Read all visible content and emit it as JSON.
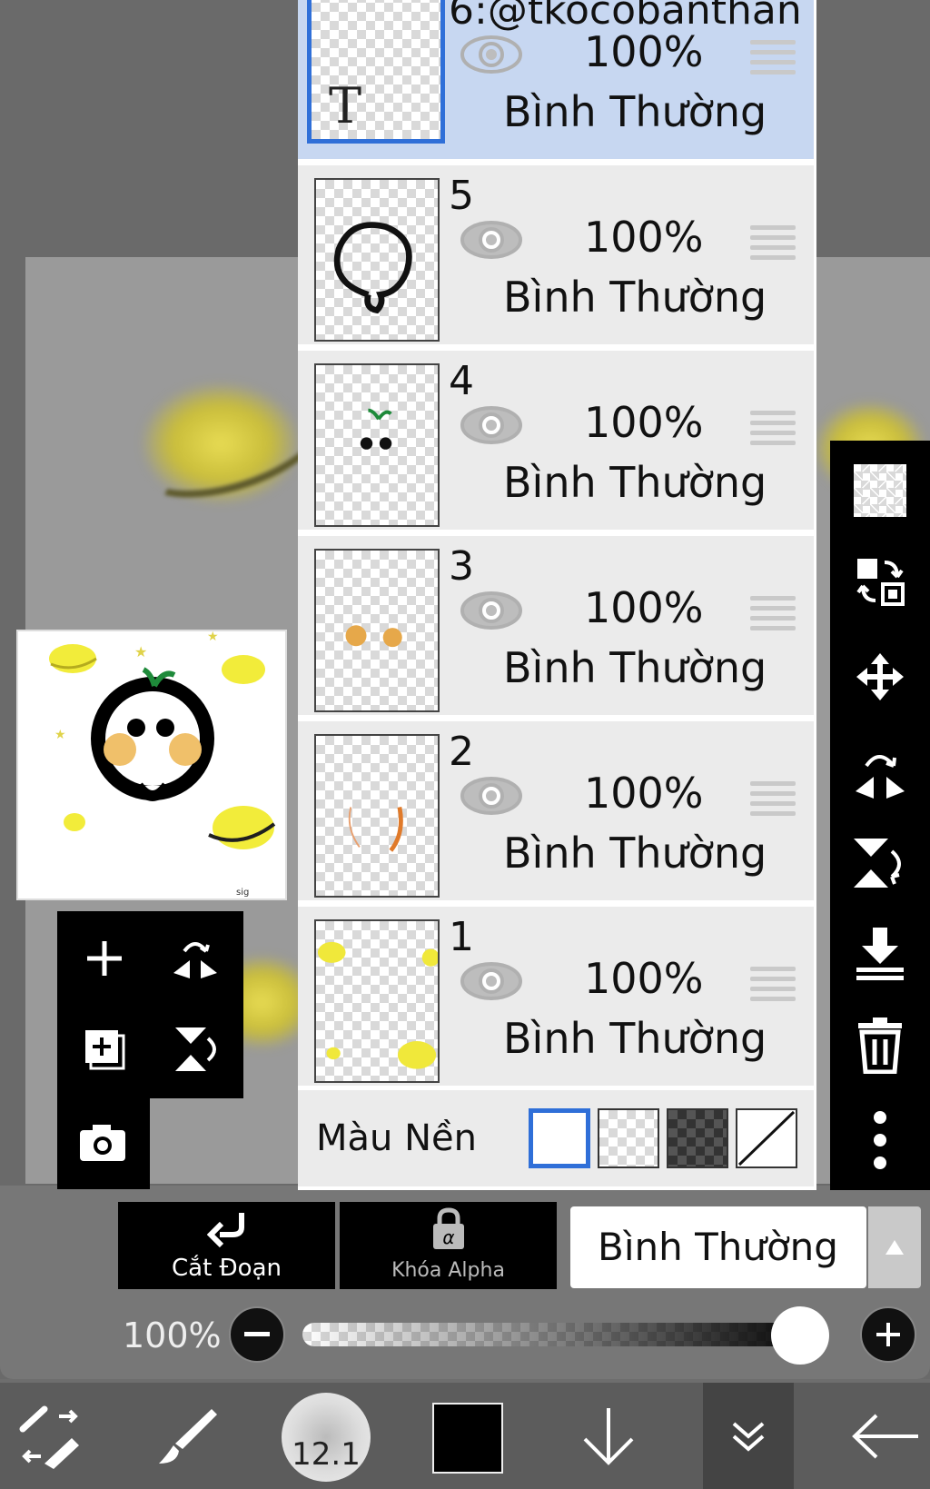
{
  "layers": [
    {
      "name": "6:@tkocobanthan",
      "opacity": "100%",
      "blend": "Bình Thường",
      "selected": true,
      "thumb": "text-layer",
      "thumb_text": "T"
    },
    {
      "name": "5",
      "opacity": "100%",
      "blend": "Bình Thường",
      "selected": false,
      "thumb": "outline"
    },
    {
      "name": "4",
      "opacity": "100%",
      "blend": "Bình Thường",
      "selected": false,
      "thumb": "eyes-sprout"
    },
    {
      "name": "3",
      "opacity": "100%",
      "blend": "Bình Thường",
      "selected": false,
      "thumb": "cheeks"
    },
    {
      "name": "2",
      "opacity": "100%",
      "blend": "Bình Thường",
      "selected": false,
      "thumb": "orange-strokes"
    },
    {
      "name": "1",
      "opacity": "100%",
      "blend": "Bình Thường",
      "selected": false,
      "thumb": "yellow-planets"
    }
  ],
  "background": {
    "label": "Màu Nền",
    "swatches": [
      "white",
      "checker-light",
      "checker-dark",
      "none"
    ],
    "selected_index": 0
  },
  "blend_bar": {
    "clip_label": "Cắt Đoạn",
    "alpha_lock_label": "Khóa Alpha",
    "blend_mode": "Bình Thường"
  },
  "opacity_slider": {
    "label": "100%",
    "value": 1.0
  },
  "bottom_bar": {
    "brush_size": "12.1",
    "current_color": "#000000"
  },
  "colors": {
    "selection_blue": "#2f6fd8",
    "selected_row": "#c7d7f1",
    "row": "#ebebeb",
    "toolbar": "#000000"
  }
}
